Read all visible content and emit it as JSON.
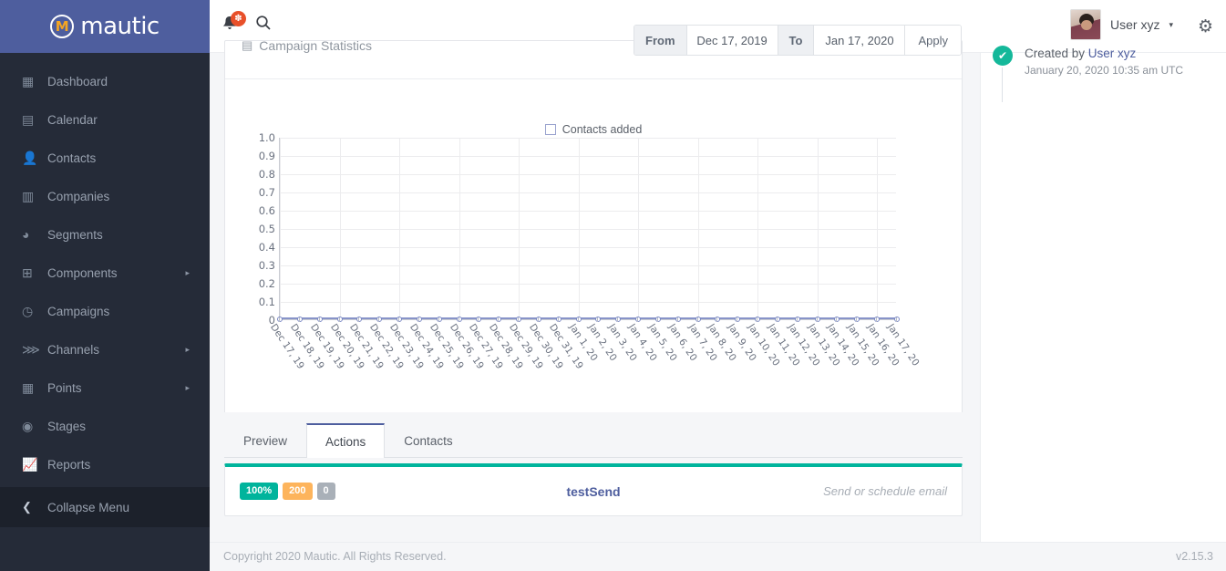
{
  "brand": {
    "name": "mautic",
    "mark": "M"
  },
  "sidebar": {
    "items": [
      {
        "label": "Dashboard",
        "icon": "grid-icon",
        "glyph": "▦",
        "caret": ""
      },
      {
        "label": "Calendar",
        "icon": "calendar-icon",
        "glyph": "▤",
        "caret": ""
      },
      {
        "label": "Contacts",
        "icon": "user-icon",
        "glyph": "👤",
        "caret": ""
      },
      {
        "label": "Companies",
        "icon": "building-icon",
        "glyph": "▥",
        "caret": ""
      },
      {
        "label": "Segments",
        "icon": "pie-chart-icon",
        "glyph": "◕",
        "caret": ""
      },
      {
        "label": "Components",
        "icon": "puzzle-icon",
        "glyph": "⊞",
        "caret": "▸"
      },
      {
        "label": "Campaigns",
        "icon": "clock-icon",
        "glyph": "◷",
        "caret": ""
      },
      {
        "label": "Channels",
        "icon": "rss-icon",
        "glyph": "⋙",
        "caret": "▸"
      },
      {
        "label": "Points",
        "icon": "table-icon",
        "glyph": "▦",
        "caret": "▸"
      },
      {
        "label": "Stages",
        "icon": "gauge-icon",
        "glyph": "◉",
        "caret": ""
      },
      {
        "label": "Reports",
        "icon": "line-chart-icon",
        "glyph": "📈",
        "caret": ""
      }
    ],
    "collapse": {
      "label": "Collapse Menu",
      "icon": "chevron-left-icon",
      "glyph": "❮"
    }
  },
  "topbar": {
    "notifications_badge": "✽",
    "search_glyph": "⌕",
    "user_name": "User xyz",
    "user_caret": "▾",
    "gear_glyph": "⚙"
  },
  "panel": {
    "title": "Campaign Statistics",
    "title_icon_glyph": "▤",
    "daterange": {
      "from_label": "From",
      "from_value": "Dec 17, 2019",
      "to_label": "To",
      "to_value": "Jan 17, 2020",
      "apply_label": "Apply"
    }
  },
  "chart_data": {
    "type": "line",
    "title": "Campaign Statistics",
    "xlabel": "",
    "ylabel": "",
    "ylim": [
      0,
      1.0
    ],
    "yticks": [
      "1.0",
      "0.9",
      "0.8",
      "0.7",
      "0.6",
      "0.5",
      "0.4",
      "0.3",
      "0.2",
      "0.1",
      "0"
    ],
    "grid": true,
    "legend_position": "top-center",
    "legend": [
      "Contacts added"
    ],
    "legend_color": "#9aa3cf",
    "categories": [
      "Dec 17, 19",
      "Dec 18, 19",
      "Dec 19, 19",
      "Dec 20, 19",
      "Dec 21, 19",
      "Dec 22, 19",
      "Dec 23, 19",
      "Dec 24, 19",
      "Dec 25, 19",
      "Dec 26, 19",
      "Dec 27, 19",
      "Dec 28, 19",
      "Dec 29, 19",
      "Dec 30, 19",
      "Dec 31, 19",
      "Jan 1, 20",
      "Jan 2, 20",
      "Jan 3, 20",
      "Jan 4, 20",
      "Jan 5, 20",
      "Jan 6, 20",
      "Jan 7, 20",
      "Jan 8, 20",
      "Jan 9, 20",
      "Jan 10, 20",
      "Jan 11, 20",
      "Jan 12, 20",
      "Jan 13, 20",
      "Jan 14, 20",
      "Jan 15, 20",
      "Jan 16, 20",
      "Jan 17, 20"
    ],
    "series": [
      {
        "name": "Contacts added",
        "color": "#7b89c4",
        "values": [
          0,
          0,
          0,
          0,
          0,
          0,
          0,
          0,
          0,
          0,
          0,
          0,
          0,
          0,
          0,
          0,
          0,
          0,
          0,
          0,
          0,
          0,
          0,
          0,
          0,
          0,
          0,
          0,
          0,
          0,
          0,
          0
        ]
      }
    ]
  },
  "tabs": [
    {
      "label": "Preview",
      "active": false
    },
    {
      "label": "Actions",
      "active": true
    },
    {
      "label": "Contacts",
      "active": false
    }
  ],
  "action": {
    "badge_percent": "100%",
    "badge_count": "200",
    "badge_zero": "0",
    "name": "testSend",
    "description": "Send or schedule email",
    "accent_color": "#00b49c"
  },
  "timeline": {
    "check_glyph": "✔",
    "created_prefix": "Created by ",
    "created_by": "User xyz",
    "date": "January 20, 2020 10:35 am UTC"
  },
  "footer": {
    "copyright": "Copyright 2020 Mautic. All Rights Reserved.",
    "version": "v2.15.3"
  }
}
